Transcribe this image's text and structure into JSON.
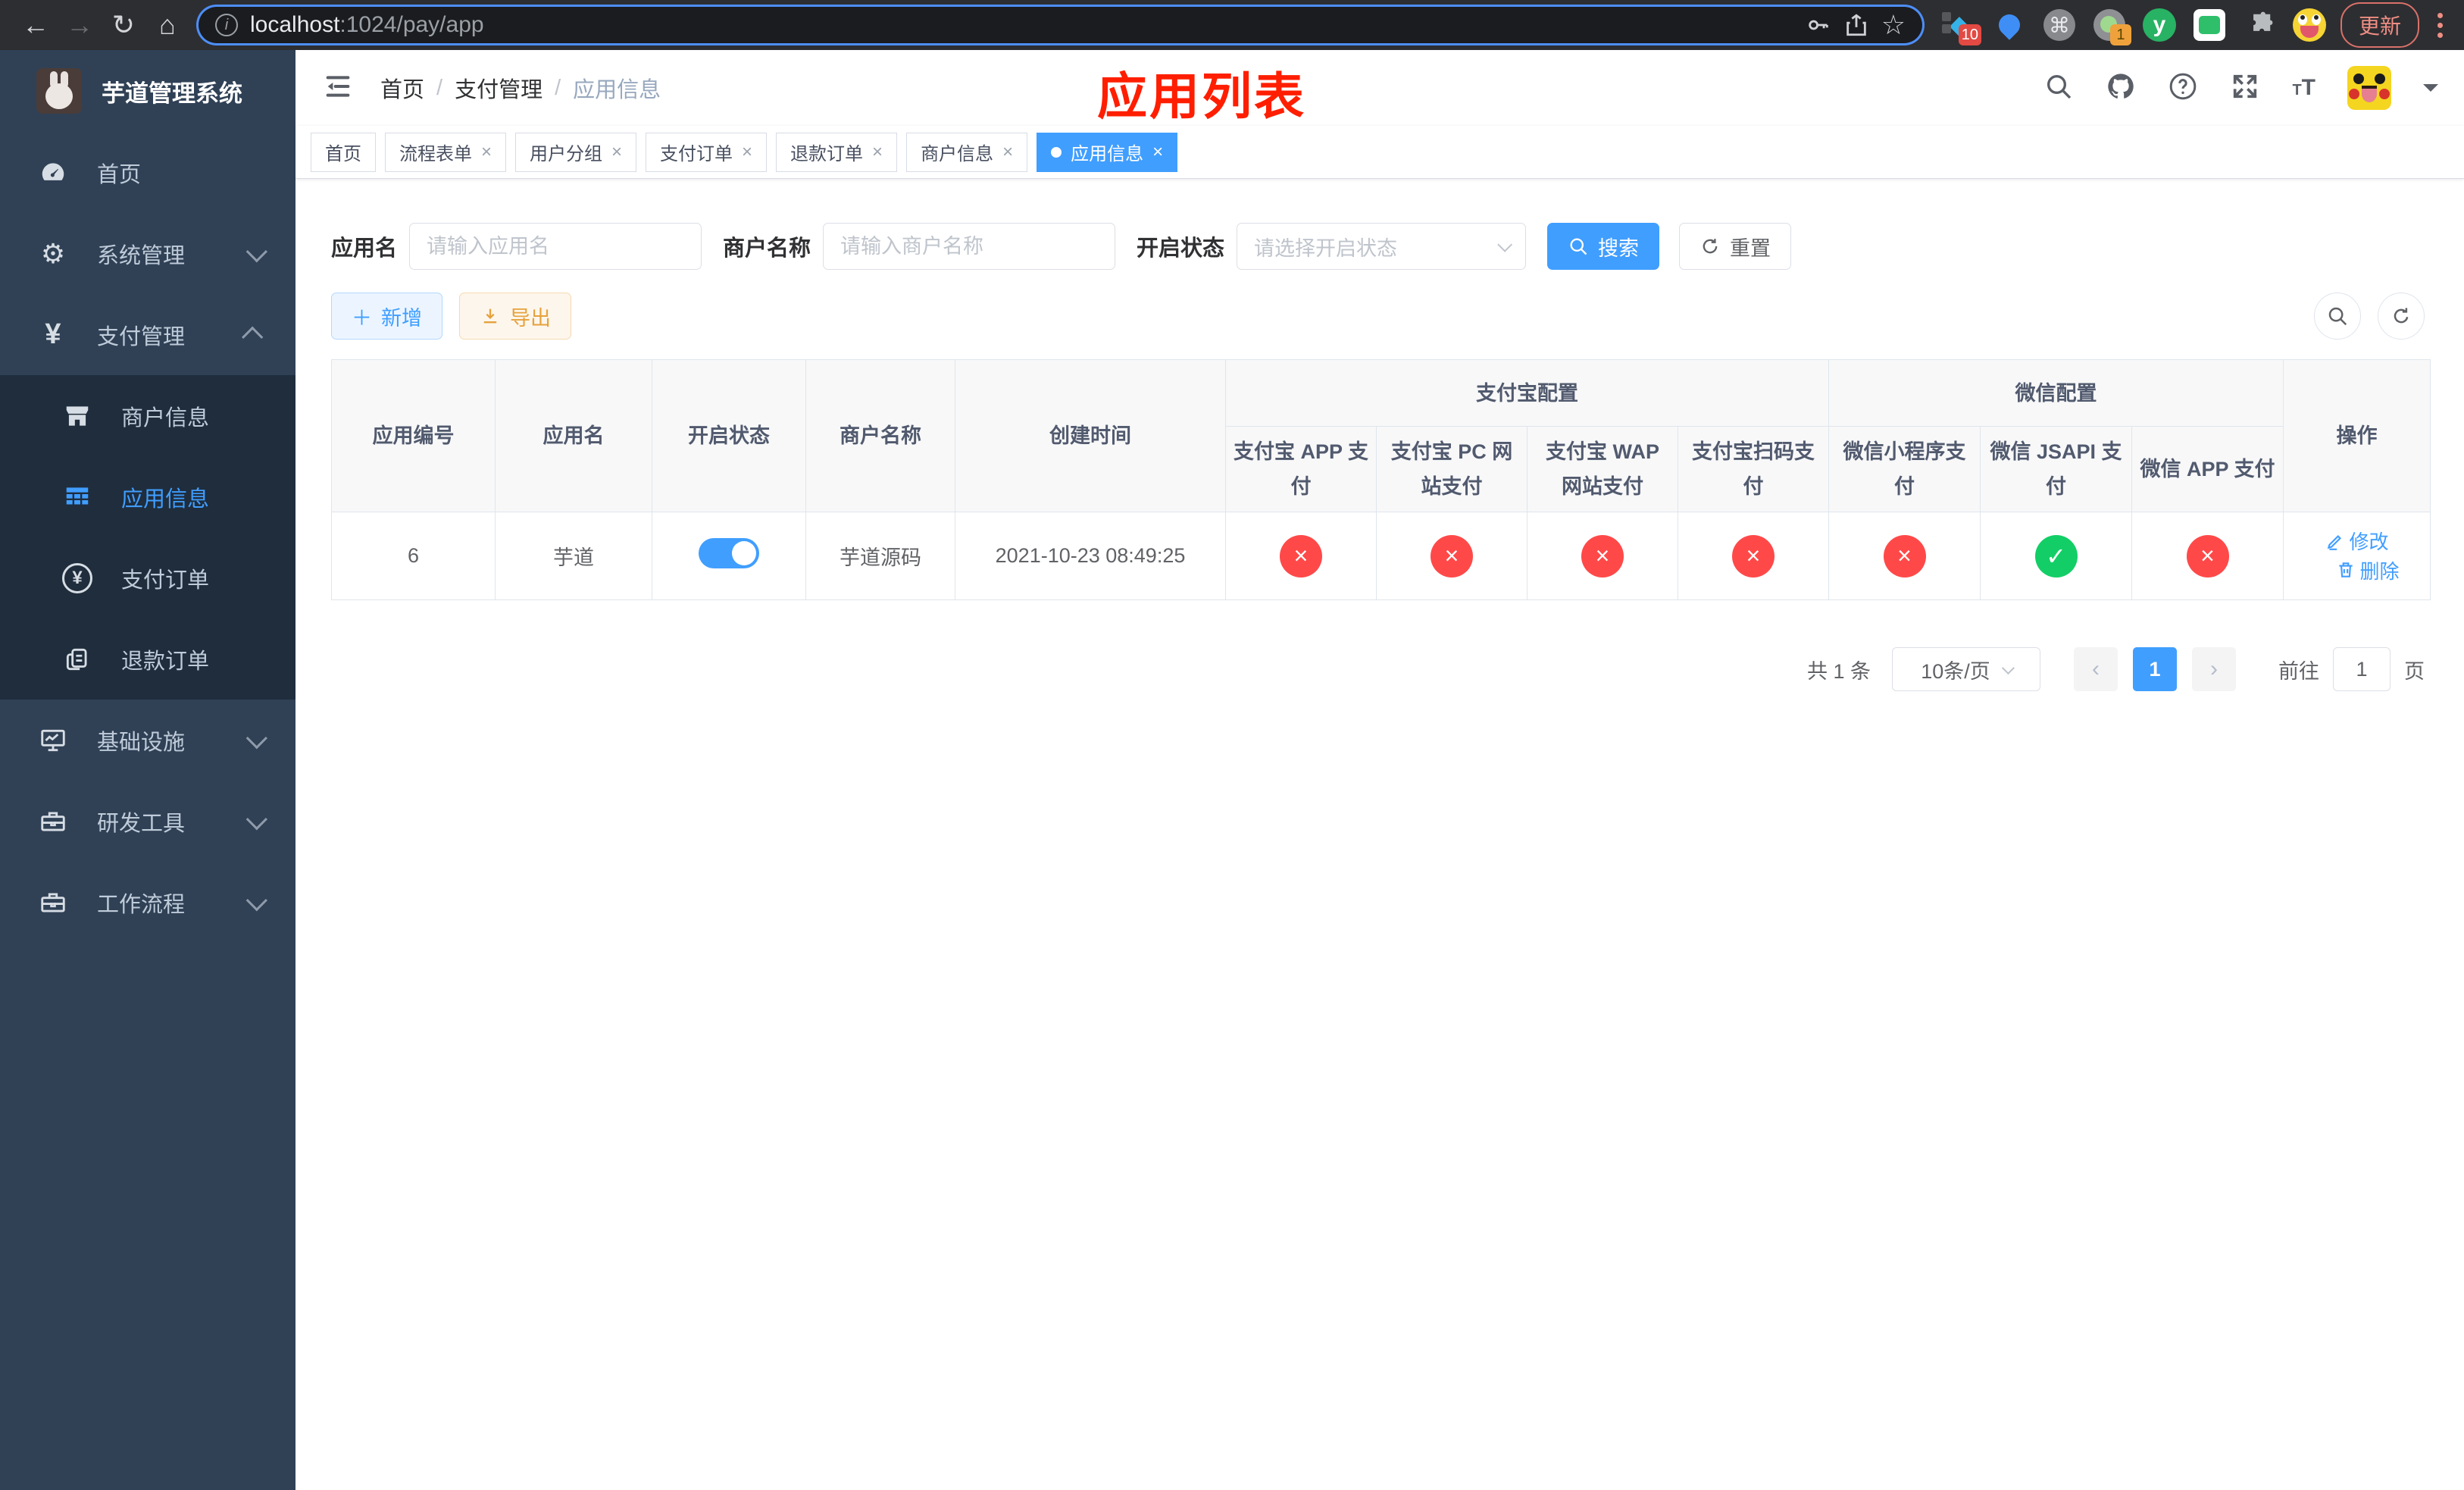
{
  "browser": {
    "url_host": "localhost",
    "url_rest": ":1024/pay/app",
    "update_label": "更新",
    "ext_badge_10": "10",
    "ext_badge_1": "1",
    "ext_y_label": "y"
  },
  "icons": {
    "back": "←",
    "forward": "→",
    "reload": "↻",
    "home": "⌂",
    "info": "i",
    "star": "☆",
    "command": "⌘",
    "yen": "¥",
    "check": "✓",
    "cross": "×",
    "prev": "‹",
    "next": "›"
  },
  "colors": {
    "accent": "#409eff",
    "success": "#13ce66",
    "danger": "#ff4949",
    "warning": "#e6a23c",
    "annotation_red": "#ff1e00",
    "sidebar_bg": "#304156",
    "submenu_bg": "#1f2d3d"
  },
  "sidebar": {
    "title": "芋道管理系统",
    "items": {
      "home": "首页",
      "system": "系统管理",
      "pay": "支付管理",
      "infra": "基础设施",
      "devtools": "研发工具",
      "workflow": "工作流程"
    },
    "pay_children": {
      "merchant": "商户信息",
      "app": "应用信息",
      "order": "支付订单",
      "refund": "退款订单"
    }
  },
  "header": {
    "breadcrumb": [
      "首页",
      "支付管理",
      "应用信息"
    ],
    "separator": "/",
    "annotation": "应用列表"
  },
  "tabs": [
    {
      "label": "首页"
    },
    {
      "label": "流程表单"
    },
    {
      "label": "用户分组"
    },
    {
      "label": "支付订单"
    },
    {
      "label": "退款订单"
    },
    {
      "label": "商户信息"
    },
    {
      "label": "应用信息"
    }
  ],
  "filters": {
    "app_name_label": "应用名",
    "app_name_placeholder": "请输入应用名",
    "merchant_label": "商户名称",
    "merchant_placeholder": "请输入商户名称",
    "status_label": "开启状态",
    "status_placeholder": "请选择开启状态",
    "search_label": "搜索",
    "reset_label": "重置"
  },
  "toolbar": {
    "add_label": "新增",
    "export_label": "导出"
  },
  "table": {
    "headers": {
      "app_id": "应用编号",
      "app_name": "应用名",
      "status": "开启状态",
      "merchant": "商户名称",
      "created": "创建时间",
      "alipay_group": "支付宝配置",
      "wechat_group": "微信配置",
      "op": "操作",
      "alipay_cols": [
        "支付宝 APP 支付",
        "支付宝 PC 网站支付",
        "支付宝 WAP 网站支付",
        "支付宝扫码支付"
      ],
      "wechat_cols": [
        "微信小程序支付",
        "微信 JSAPI 支付",
        "微信 APP 支付"
      ]
    },
    "rows": [
      {
        "id": "6",
        "name": "芋道",
        "enabled": true,
        "merchant": "芋道源码",
        "created": "2021-10-23 08:49:25",
        "alipay": [
          false,
          false,
          false,
          false
        ],
        "wechat": [
          false,
          true,
          false
        ],
        "edit_label": "修改",
        "delete_label": "删除"
      }
    ]
  },
  "pagination": {
    "total": "共 1 条",
    "size": "10条/页",
    "page": "1",
    "goto_label": "前往",
    "goto_value": "1",
    "unit": "页"
  }
}
